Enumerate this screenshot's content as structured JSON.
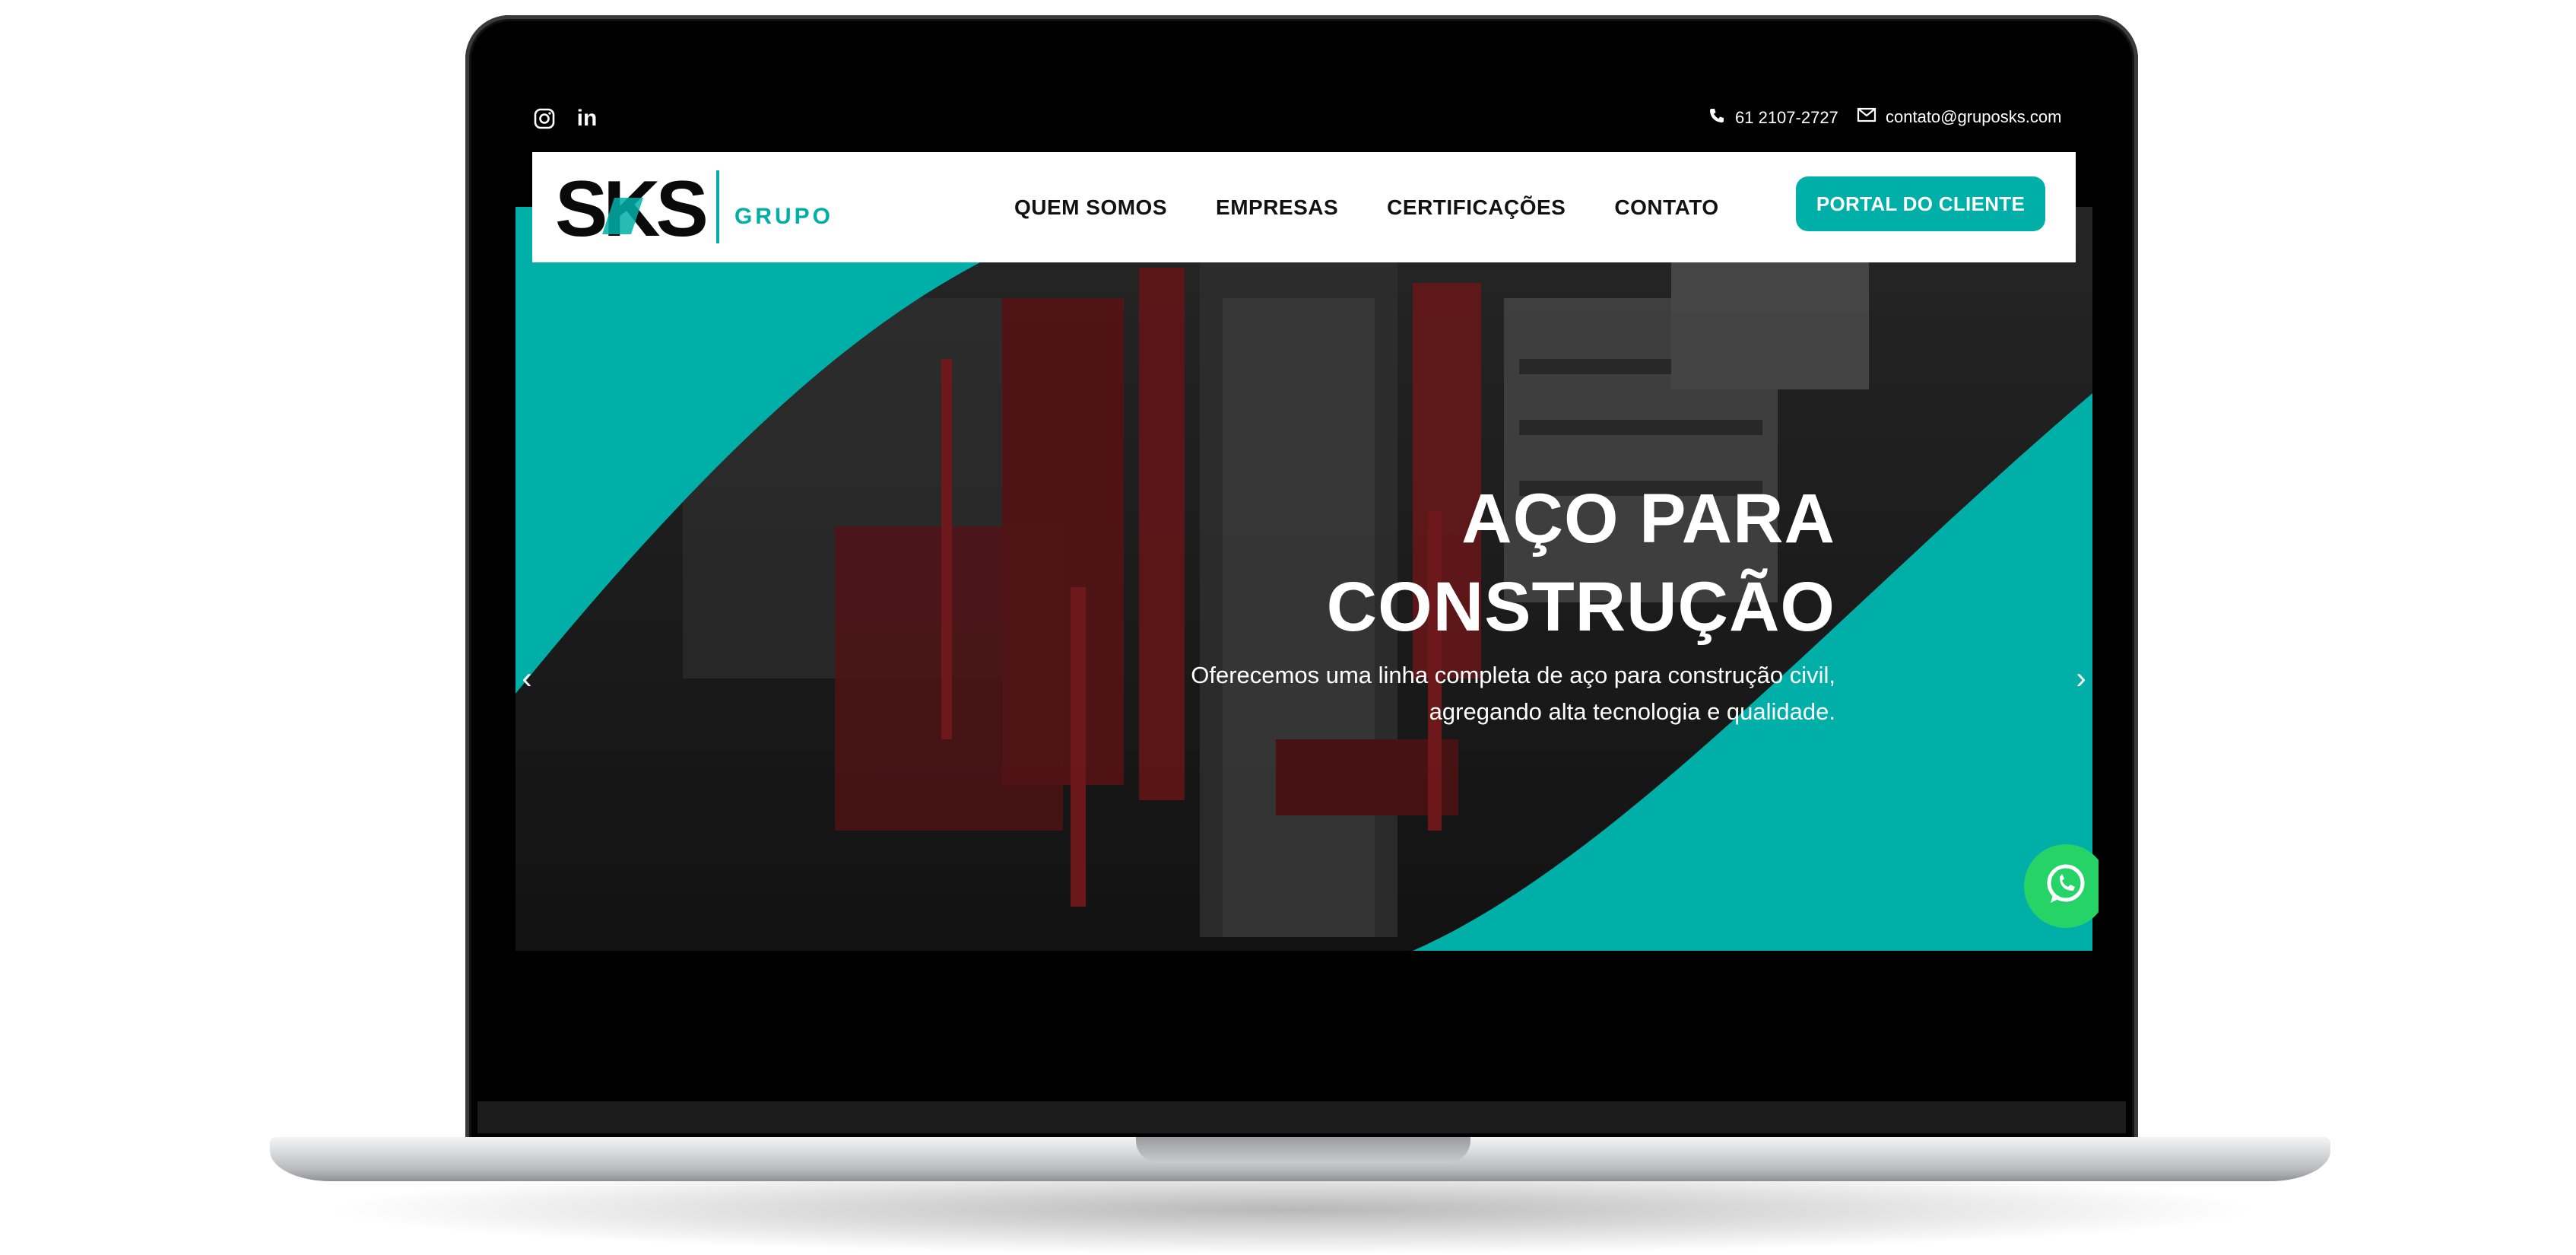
{
  "topbar": {
    "social": [
      {
        "icon": "instagram-icon"
      },
      {
        "icon": "linkedin-icon",
        "label": "in"
      }
    ],
    "phone": {
      "icon": "phone-icon",
      "text": "61 2107-2727"
    },
    "email": {
      "icon": "mail-icon",
      "text": "contato@gruposks.com"
    }
  },
  "header": {
    "logo": {
      "mark": "SKS",
      "tagline": "GRUPO"
    },
    "nav": [
      {
        "label": "QUEM SOMOS"
      },
      {
        "label": "EMPRESAS"
      },
      {
        "label": "CERTIFICAÇÕES"
      },
      {
        "label": "CONTATO"
      }
    ],
    "portal_button": "PORTAL DO CLIENTE"
  },
  "hero": {
    "title_line1": "AÇO PARA",
    "title_line2": "CONSTRUÇÃO",
    "subtitle_line1": "Oferecemos uma linha completa de aço para construção civil,",
    "subtitle_line2": "agregando alta tecnologia e qualidade.",
    "prev_arrow": "‹",
    "next_arrow": "›"
  },
  "colors": {
    "accent": "#00b0a8",
    "logo_dark": "#0a0a0a",
    "text_dark": "#111111",
    "whatsapp": "#25d366"
  }
}
